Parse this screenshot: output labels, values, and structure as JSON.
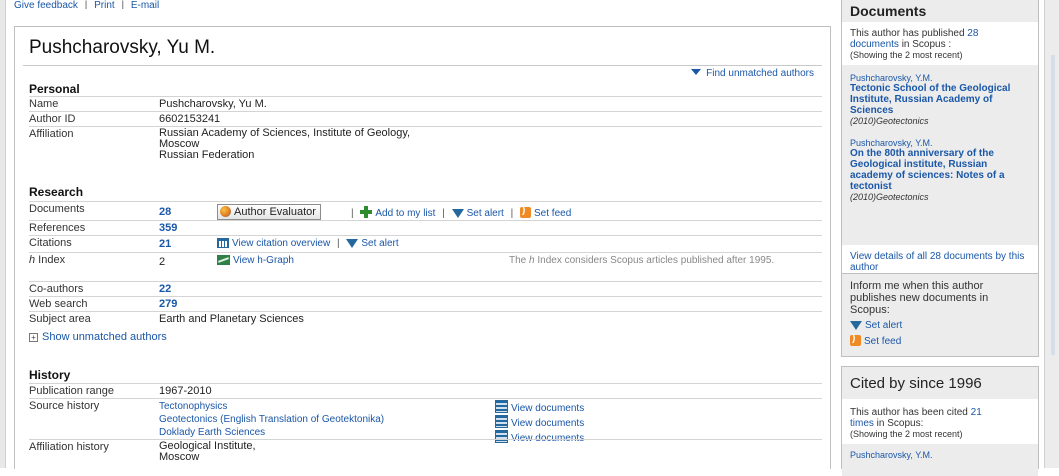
{
  "toolbar": {
    "give_feedback": "Give feedback",
    "print": "Print",
    "email": "E-mail"
  },
  "author": {
    "name": "Pushcharovsky, Yu M.",
    "find_unmatched": "Find unmatched authors"
  },
  "personal": {
    "heading": "Personal",
    "name_label": "Name",
    "name_value": "Pushcharovsky, Yu M.",
    "id_label": "Author ID",
    "id_value": "6602153241",
    "affiliation_label": "Affiliation",
    "affiliation_lines": [
      "Russian Academy of Sciences, Institute of Geology,",
      "Moscow",
      "Russian Federation"
    ]
  },
  "research": {
    "heading": "Research",
    "documents_label": "Documents",
    "documents_value": "28",
    "author_evaluator": "Author Evaluator",
    "add_to_list": "Add to my list",
    "set_alert": "Set alert",
    "set_feed": "Set feed",
    "references_label": "References",
    "references_value": "359",
    "citations_label": "Citations",
    "citations_value": "21",
    "view_citation_overview": "View citation overview",
    "h_index_prefix": "h",
    "h_index_label": " Index",
    "h_index_value": "2",
    "view_h_graph": "View h-Graph",
    "h_note_pre": "The ",
    "h_note_h": "h",
    "h_note_post": " Index considers Scopus articles published after 1995.",
    "coauthors_label": "Co-authors",
    "coauthors_value": "22",
    "web_search_label": "Web search",
    "web_search_value": "279",
    "subject_label": "Subject area",
    "subject_value": "Earth and Planetary Sciences",
    "show_unmatched": "Show unmatched authors"
  },
  "history": {
    "heading": "History",
    "pub_range_label": "Publication range",
    "pub_range_value": "1967-2010",
    "source_label": "Source history",
    "sources": [
      {
        "name": "Tectonophysics",
        "action": "View documents"
      },
      {
        "name": "Geotectonics (English Translation of Geotektonika)",
        "action": "View documents"
      },
      {
        "name": "Doklady Earth Sciences",
        "action": "View documents"
      }
    ],
    "aff_history_label": "Affiliation history",
    "aff_history_lines": [
      "Geological Institute,",
      "Moscow"
    ]
  },
  "sidebar": {
    "documents_heading": "Documents",
    "published_pre": "This author has published ",
    "published_count": "28",
    "published_link": "documents",
    "published_post": " in Scopus :",
    "showing": "(Showing the 2 most recent)",
    "docs": [
      {
        "author": "Pushcharovsky, Y.M.",
        "title": "Tectonic School of the Geological Institute, Russian Academy of Sciences",
        "source": "(2010)Geotectonics"
      },
      {
        "author": "Pushcharovsky, Y.M.",
        "title": "On the 80th anniversary of the Geological institute, Russian academy of sciences: Notes of a tectonist",
        "source": "(2010)Geotectonics"
      }
    ],
    "view_all": "View details of all 28 documents by this author",
    "inform_text": "Inform me when this author publishes new documents in Scopus:",
    "set_alert": "Set alert",
    "set_feed": "Set feed",
    "cited_heading": "Cited by since 1996",
    "cited_pre": "This author has been cited ",
    "cited_count": "21",
    "cited_link": "times",
    "cited_post": " in Scopus:",
    "cited_showing": "(Showing the 2 most recent)",
    "cited_author": "Pushcharovsky, Y.M."
  },
  "colors": {
    "link": "#1a57a8",
    "feed": "#f08a24",
    "add": "#2e8b2e"
  }
}
